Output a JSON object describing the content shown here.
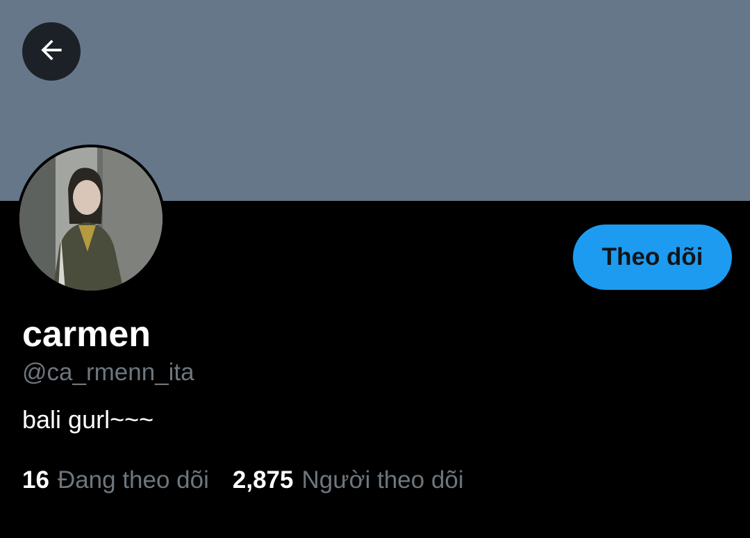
{
  "profile": {
    "display_name": "carmen",
    "handle": "@ca_rmenn_ita",
    "bio": "bali gurl~~~"
  },
  "actions": {
    "follow_label": "Theo dõi",
    "back_icon": "arrow-left-icon"
  },
  "stats": {
    "following_count": "16",
    "following_label": "Đang theo dõi",
    "followers_count": "2,875",
    "followers_label": "Người theo dõi"
  },
  "colors": {
    "banner": "#66778a",
    "background": "#000000",
    "accent": "#1d9bf0",
    "secondary_text": "#6e767d"
  }
}
